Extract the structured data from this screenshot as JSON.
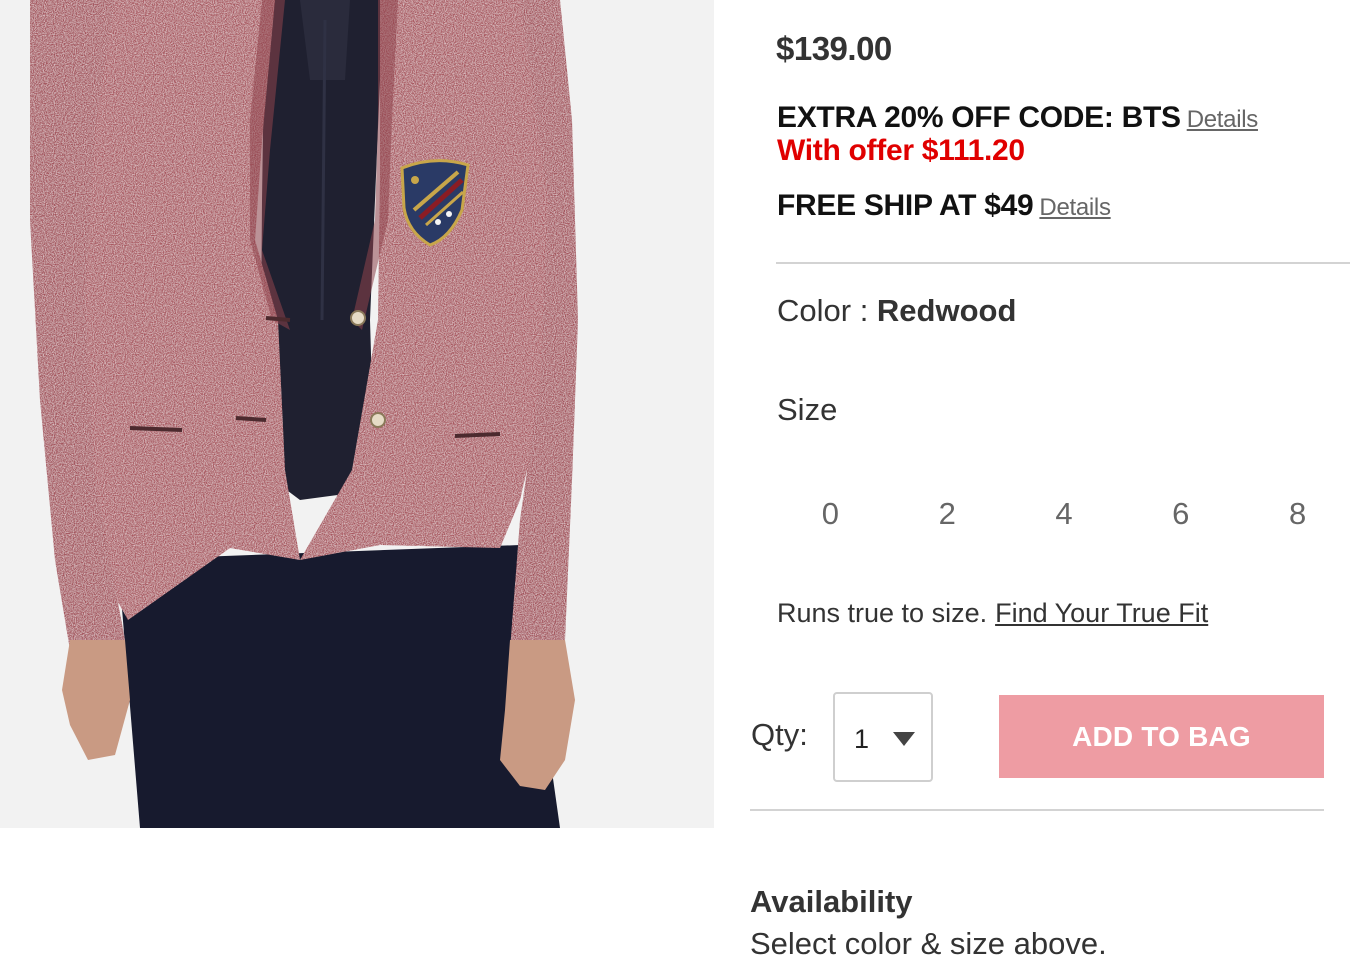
{
  "product": {
    "image_alt": "Redwood tweed blazer with crest patch",
    "price": "$139.00",
    "promo_code": "EXTRA 20% OFF CODE: BTS",
    "promo_details_link": "Details",
    "offer_price": "With offer $111.20",
    "shipping": "FREE SHIP AT $49",
    "shipping_details_link": "Details"
  },
  "color": {
    "label": "Color : ",
    "value": "Redwood"
  },
  "size": {
    "label": "Size",
    "options": [
      "0",
      "2",
      "4",
      "6",
      "8"
    ],
    "fit_note": "Runs true to size.",
    "fit_link": "Find Your True Fit"
  },
  "purchase": {
    "qty_label": "Qty:",
    "qty_value": "1",
    "add_to_bag": "ADD TO BAG"
  },
  "availability": {
    "title": "Availability",
    "text": "Select color & size above."
  },
  "colors": {
    "blazer": "#a8575f",
    "offer_red": "#e00000",
    "add_button": "#ee9ca3",
    "shirt": "#1f2030",
    "pants": "#171a2e"
  }
}
